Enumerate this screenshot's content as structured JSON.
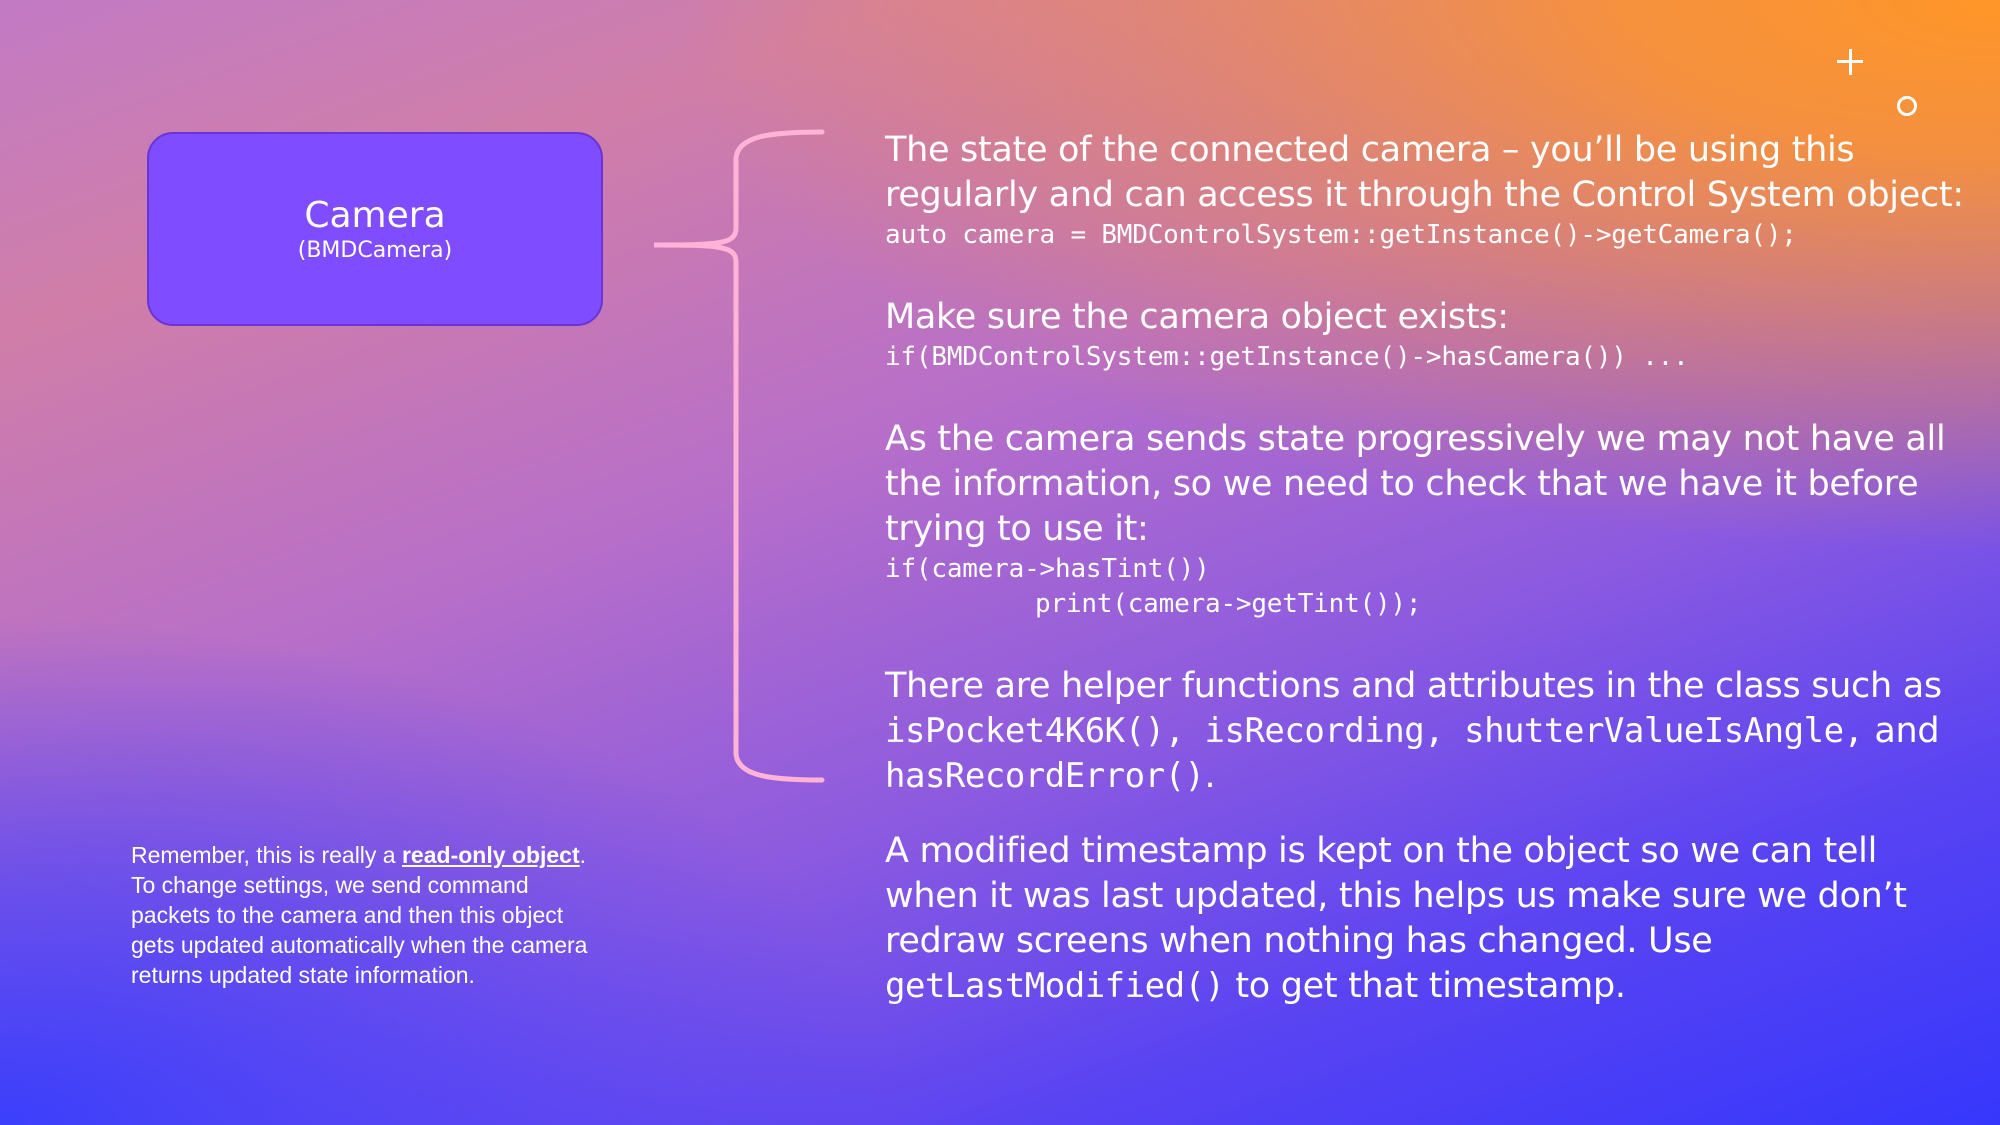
{
  "card": {
    "title": "Camera",
    "subtitle": "(BMDCamera)"
  },
  "note": {
    "pre": "Remember, this is really a ",
    "emphasis": "read-only object",
    "post": ". To change settings, we send command packets to the camera and then this object gets updated automatically when the camera returns updated state information."
  },
  "sections": {
    "state": {
      "text": "The state of the connected camera – you’ll be using this regularly and can access it through the Control System object:",
      "code": "auto camera = BMDControlSystem::getInstance()->getCamera();"
    },
    "exists": {
      "text": "Make sure the camera object exists:",
      "code": "if(BMDControlSystem::getInstance()->hasCamera()) ..."
    },
    "progressive": {
      "text": "As the camera sends state progressively we may not have all the information, so we need to check that we have it before trying to use it:",
      "code_line1": "if(camera->hasTint())",
      "code_line2": "print(camera->getTint());"
    },
    "helpers": {
      "text_pre": "There are helper functions and attributes in the class such as ",
      "code1": "isPocket4K6K(), isRecording, shutterValueIsAngle,",
      "text_and": " and ",
      "code2": "hasRecordError()",
      "text_post": "."
    },
    "timestamp": {
      "text": "A modified timestamp is kept on the object so we can tell when it was last updated, this helps us make sure we don’t redraw screens when nothing has changed. Use ",
      "code": "getLastModified()",
      "text_post": " to get that timestamp."
    }
  },
  "colors": {
    "card_fill": "#7f4cff",
    "brace": "#ffb3d6",
    "text": "#ffffff"
  },
  "icons": [
    "plus-icon",
    "circle-icon"
  ]
}
